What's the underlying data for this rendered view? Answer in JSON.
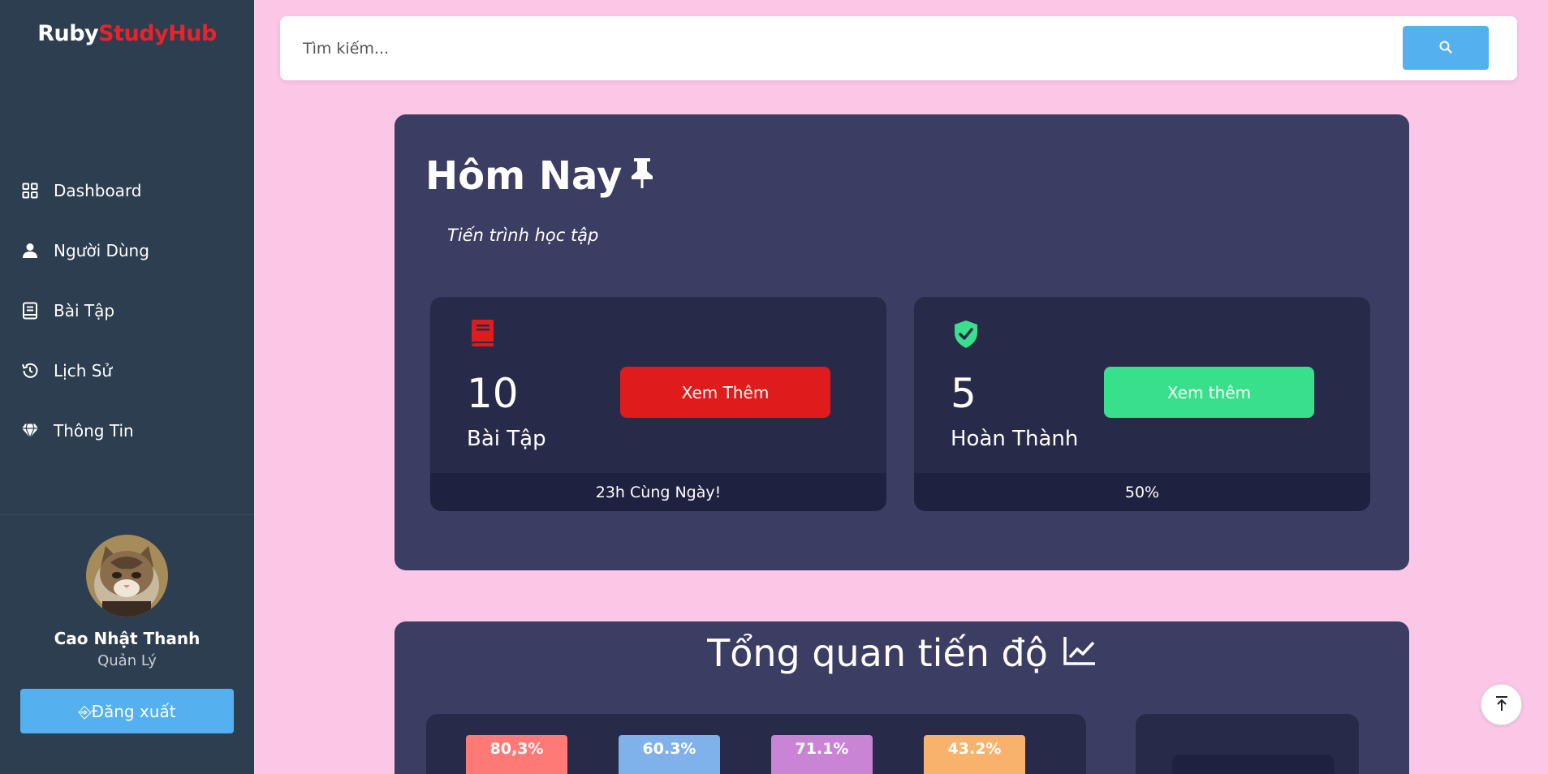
{
  "app": {
    "logo_part1": "Ruby",
    "logo_part2": "StudyHub",
    "brand_color": "#e8232a",
    "sidebar_color": "#2c3e50",
    "background_color": "#fcc6e6"
  },
  "sidebar": {
    "items": [
      {
        "label": "Dashboard",
        "icon": "grid-icon"
      },
      {
        "label": "Người Dùng",
        "icon": "user-icon"
      },
      {
        "label": "Bài Tập",
        "icon": "book-icon"
      },
      {
        "label": "Lịch Sử",
        "icon": "history-icon"
      },
      {
        "label": "Thông Tin",
        "icon": "diamond-icon"
      }
    ],
    "user": {
      "name": "Cao Nhật Thanh",
      "role": "Quản Lý"
    },
    "logout_label": "⎆Đăng xuất"
  },
  "search": {
    "placeholder": "Tìm kiếm...",
    "value": ""
  },
  "today": {
    "title": "Hôm Nay",
    "subtitle": "Tiến trình học tập",
    "cards": [
      {
        "count": "10",
        "label": "Bài Tập",
        "button": "Xem Thêm",
        "footer": "23h Cùng Ngày!",
        "icon": "book-icon",
        "color": "#e01b1b"
      },
      {
        "count": "5",
        "label": "Hoàn Thành",
        "button": "Xem thêm",
        "footer": "50%",
        "icon": "shield-check-icon",
        "color": "#38e08c"
      }
    ]
  },
  "overview": {
    "title": "Tổng quan tiến độ",
    "bars": [
      {
        "label": "80,3%",
        "value": 80.3,
        "color": "#ff7a76"
      },
      {
        "label": "60.3%",
        "value": 60.3,
        "color": "#7fb2ea"
      },
      {
        "label": "71.1%",
        "value": 71.1,
        "color": "#c984d6"
      },
      {
        "label": "43.2%",
        "value": 43.2,
        "color": "#f9b26b"
      }
    ]
  }
}
